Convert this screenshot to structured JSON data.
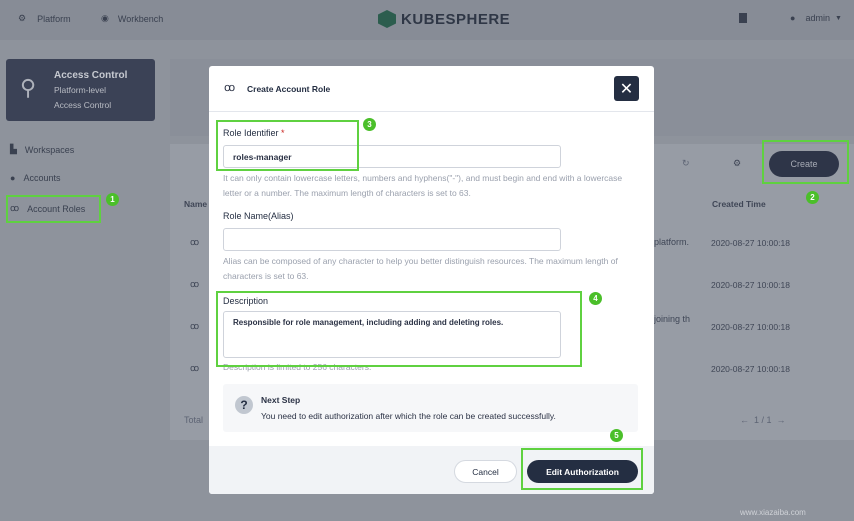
{
  "topbar": {
    "platform": "Platform",
    "workbench": "Workbench",
    "logo": "KUBESPHERE",
    "user": "admin"
  },
  "sidebar": {
    "card_title": "Access Control",
    "card_sub1": "Platform-level",
    "card_sub2": "Access Control",
    "items": [
      {
        "label": "Workspaces"
      },
      {
        "label": "Accounts"
      },
      {
        "label": "Account Roles"
      }
    ]
  },
  "table": {
    "name_header": "Name",
    "time_header": "Created Time",
    "rows": [
      {
        "desc": "platform.",
        "time": "2020-08-27 10:00:18"
      },
      {
        "desc": "",
        "time": "2020-08-27 10:00:18"
      },
      {
        "desc": "joining th",
        "time": "2020-08-27 10:00:18"
      },
      {
        "desc": "",
        "time": "2020-08-27 10:00:18"
      }
    ],
    "total": "Total",
    "pagination": "1 / 1",
    "create": "Create"
  },
  "modal": {
    "title": "Create Account Role",
    "close": "✕",
    "role_identifier_label": "Role Identifier",
    "required": "*",
    "role_identifier_value": "roles-manager",
    "role_identifier_hint": "It can only contain lowercase letters, numbers and hyphens(\"-\"), and must begin and end with a lowercase letter or a number. The maximum length of characters is set to 63.",
    "role_name_label": "Role Name(Alias)",
    "role_name_value": "",
    "role_name_hint": "Alias can be composed of any character to help you better distinguish resources. The maximum length of characters is set to 63.",
    "description_label": "Description",
    "description_value": "Responsible for role management, including adding and deleting roles.",
    "description_hint": "Description is limited to 256 characters.",
    "next_step_title": "Next Step",
    "next_step_text": "You need to edit authorization after which the role can be created successfully.",
    "cancel": "Cancel",
    "edit_authorization": "Edit Authorization"
  },
  "annotations": [
    "1",
    "2",
    "3",
    "4",
    "5"
  ],
  "watermark": "www.xiazaiba.com",
  "colors": {
    "annotation": "#5fd140",
    "primary": "#242e42"
  }
}
